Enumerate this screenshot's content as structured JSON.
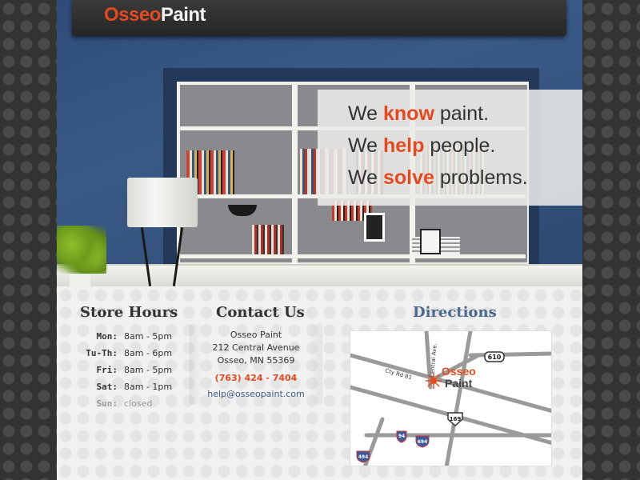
{
  "brand": {
    "part1": "Osseo",
    "part2": "Paint"
  },
  "hero": {
    "line1": {
      "pre": "We ",
      "accent": "know",
      "post": " paint."
    },
    "line2": {
      "pre": "We ",
      "accent": "help",
      "post": " people."
    },
    "line3": {
      "pre": "We ",
      "accent": "solve",
      "post": " problems."
    }
  },
  "store_hours": {
    "title": "Store Hours",
    "rows": [
      {
        "day": "Mon:",
        "time": "8am - 5pm"
      },
      {
        "day": "Tu-Th:",
        "time": "8am - 6pm"
      },
      {
        "day": "Fri:",
        "time": "8am - 5pm"
      },
      {
        "day": "Sat:",
        "time": "8am - 1pm"
      },
      {
        "day": "Sun:",
        "time": "closed"
      }
    ]
  },
  "contact": {
    "title": "Contact Us",
    "name": "Osseo Paint",
    "street": "212 Central Avenue",
    "city": "Osseo, MN 55369",
    "phone": "(763) 424 - 7404",
    "email": "help@osseopaint.com"
  },
  "directions": {
    "title": "Directions",
    "map_labels": {
      "brand1": "Osseo",
      "brand2": "Paint",
      "central_ave": "Central Ave.",
      "cty_rd": "Cty Rd 81",
      "hwy_610": "610",
      "hwy_169": "169",
      "hwy_94": "94",
      "hwy_694": "694",
      "hwy_494": "494"
    }
  },
  "colors": {
    "accent": "#e24a22",
    "link": "#3d5b85",
    "wall": "#2e4c77"
  }
}
